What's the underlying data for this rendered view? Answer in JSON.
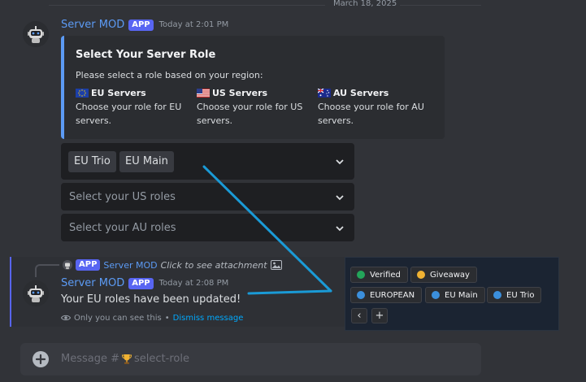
{
  "date_divider": "March 18, 2025",
  "message1": {
    "author": "Server MOD",
    "badge": "APP",
    "timestamp": "Today at 2:01 PM",
    "embed": {
      "title": "Select Your Server Role",
      "description": "Please select a role based on your region:",
      "fields": [
        {
          "name": "EU Servers",
          "flag": "eu-flag-icon",
          "value": "Choose your role for EU servers."
        },
        {
          "name": "US Servers",
          "flag": "us-flag-icon",
          "value": "Choose your role for US servers."
        },
        {
          "name": "AU Servers",
          "flag": "au-flag-icon",
          "value": "Choose your role for AU servers."
        }
      ]
    },
    "selects": {
      "eu": {
        "selected": [
          "EU Trio",
          "EU Main"
        ]
      },
      "us": {
        "placeholder": "Select your US roles"
      },
      "au": {
        "placeholder": "Select your AU roles"
      }
    }
  },
  "message2": {
    "reply": {
      "badge": "APP",
      "author": "Server MOD",
      "text": "Click to see attachment"
    },
    "author": "Server MOD",
    "badge": "APP",
    "timestamp": "Today at 2:08 PM",
    "text": "Your EU roles have been updated!",
    "ephemeral_note": "Only you can see this",
    "separator": "•",
    "dismiss_link": "Dismiss message"
  },
  "roles_panel": {
    "row1": [
      {
        "name": "Verified",
        "color": "#23a55a"
      },
      {
        "name": "Giveaway",
        "color": "#f0b232"
      }
    ],
    "row2": [
      {
        "name": "EUROPEAN",
        "color": "#3b8fdc"
      },
      {
        "name": "EU Main",
        "color": "#3b8fdc"
      },
      {
        "name": "EU Trio",
        "color": "#3b8fdc"
      }
    ],
    "nav": {
      "back": "‹",
      "add": "+"
    }
  },
  "chat_input": {
    "placeholder_prefix": "Message #",
    "channel_icon": "trophy-icon",
    "channel": "select-role"
  },
  "colors": {
    "background": "#313338",
    "embed_accent": "#5c9bf5",
    "badge": "#5865f2",
    "link": "#00a8fc",
    "arrow": "#1a9ad6"
  }
}
